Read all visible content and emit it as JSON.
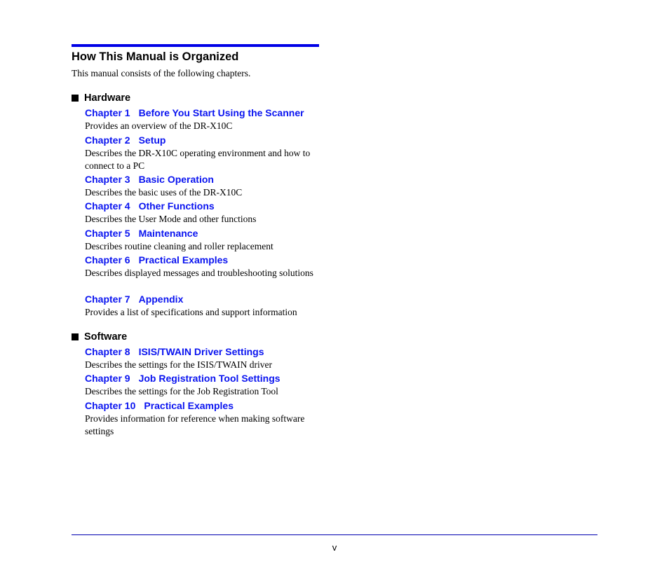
{
  "page": {
    "title": "How This Manual is Organized",
    "intro": "This manual consists of the following chapters.",
    "page_number": "v",
    "colors": {
      "rule": "#0000e6",
      "link": "#0a14f0",
      "text": "#000000"
    }
  },
  "sections": [
    {
      "heading": "Hardware",
      "icon": "black-square-bullet",
      "chapters": [
        {
          "number": "Chapter 1",
          "title": "Before You Start Using the Scanner",
          "description": "Provides an overview of the DR-X10C"
        },
        {
          "number": "Chapter 2",
          "title": "Setup",
          "description": "Describes the DR-X10C operating environment and how to connect to a PC"
        },
        {
          "number": "Chapter 3",
          "title": "Basic Operation",
          "description": "Describes the basic uses of the DR-X10C"
        },
        {
          "number": "Chapter 4",
          "title": "Other Functions",
          "description": "Describes the User Mode and other functions"
        },
        {
          "number": "Chapter 5",
          "title": "Maintenance",
          "description": "Describes routine cleaning and roller replacement"
        },
        {
          "number": "Chapter 6",
          "title": "Practical Examples",
          "description": "Describes displayed messages and troubleshooting solutions"
        },
        {
          "number": "Chapter 7",
          "title": "Appendix",
          "description": "Provides a list of specifications and support information"
        }
      ]
    },
    {
      "heading": "Software",
      "icon": "black-square-bullet",
      "chapters": [
        {
          "number": "Chapter 8",
          "title": "ISIS/TWAIN Driver Settings",
          "description": "Describes the settings for the ISIS/TWAIN driver"
        },
        {
          "number": "Chapter 9",
          "title": "Job Registration Tool Settings",
          "description": "Describes the settings for the Job Registration Tool"
        },
        {
          "number": "Chapter 10",
          "title": "Practical Examples",
          "description": "Provides information for reference when making software settings"
        }
      ]
    }
  ]
}
